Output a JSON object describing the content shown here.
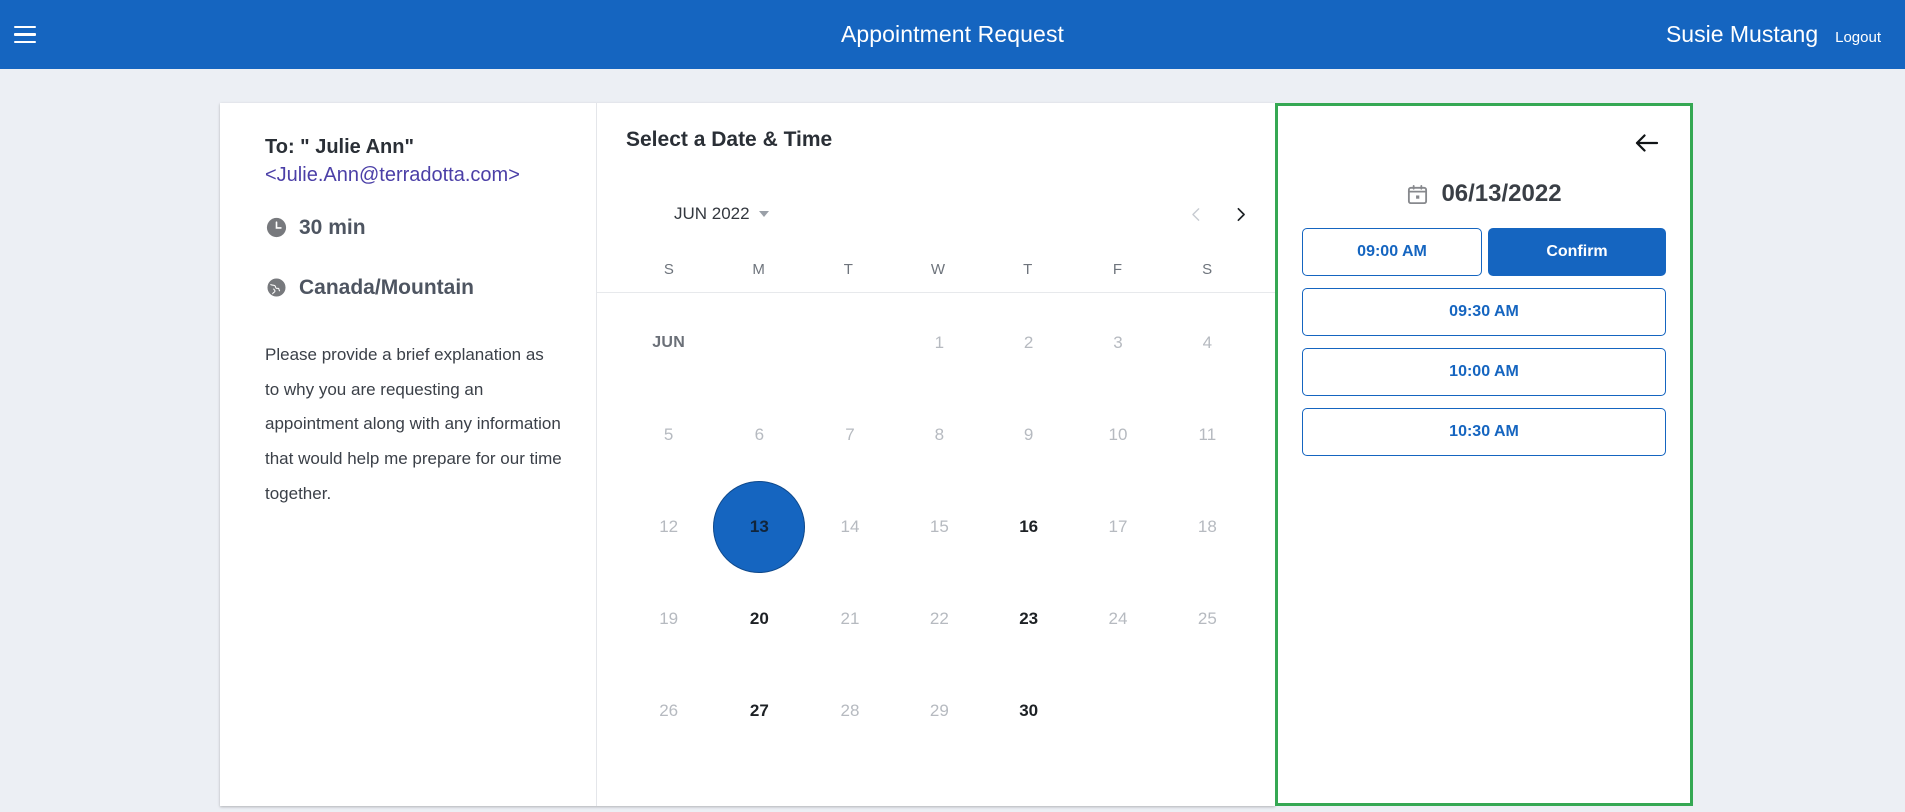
{
  "appbar": {
    "menu_icon": "hamburger-menu-icon",
    "title": "Appointment Request",
    "user_name": "Susie Mustang",
    "logout_label": "Logout",
    "background_color": "#1565c0"
  },
  "info": {
    "to_label": "To: \" Julie Ann\"",
    "to_email": "<Julie.Ann@terradotta.com>",
    "duration_icon": "clock-icon",
    "duration": "30 min",
    "timezone_icon": "globe-icon",
    "timezone": "Canada/Mountain",
    "description": "Please provide a brief explanation as to why you are requesting an appointment along with any information that would help me prepare for our time together."
  },
  "calendar": {
    "title": "Select a Date & Time",
    "month_label": "JUN 2022",
    "month_caret_icon": "chevron-down-icon",
    "prev_icon": "chevron-left-icon",
    "next_icon": "chevron-right-icon",
    "prev_disabled": true,
    "next_disabled": false,
    "weekdays": [
      "S",
      "M",
      "T",
      "W",
      "T",
      "F",
      "S"
    ],
    "month_tag": "JUN",
    "selected_day": "13",
    "weeks": [
      [
        {
          "label": "JUN",
          "type": "month-tag"
        },
        {
          "label": "",
          "type": "empty"
        },
        {
          "label": "",
          "type": "empty"
        },
        {
          "label": "1",
          "type": "disabled"
        },
        {
          "label": "2",
          "type": "disabled"
        },
        {
          "label": "3",
          "type": "disabled"
        },
        {
          "label": "4",
          "type": "disabled"
        }
      ],
      [
        {
          "label": "5",
          "type": "disabled"
        },
        {
          "label": "6",
          "type": "disabled"
        },
        {
          "label": "7",
          "type": "disabled"
        },
        {
          "label": "8",
          "type": "disabled"
        },
        {
          "label": "9",
          "type": "disabled"
        },
        {
          "label": "10",
          "type": "disabled"
        },
        {
          "label": "11",
          "type": "disabled"
        }
      ],
      [
        {
          "label": "12",
          "type": "disabled"
        },
        {
          "label": "13",
          "type": "selected"
        },
        {
          "label": "14",
          "type": "disabled"
        },
        {
          "label": "15",
          "type": "disabled"
        },
        {
          "label": "16",
          "type": "available"
        },
        {
          "label": "17",
          "type": "disabled"
        },
        {
          "label": "18",
          "type": "disabled"
        }
      ],
      [
        {
          "label": "19",
          "type": "disabled"
        },
        {
          "label": "20",
          "type": "available"
        },
        {
          "label": "21",
          "type": "disabled"
        },
        {
          "label": "22",
          "type": "disabled"
        },
        {
          "label": "23",
          "type": "available"
        },
        {
          "label": "24",
          "type": "disabled"
        },
        {
          "label": "25",
          "type": "disabled"
        }
      ],
      [
        {
          "label": "26",
          "type": "disabled"
        },
        {
          "label": "27",
          "type": "available"
        },
        {
          "label": "28",
          "type": "disabled"
        },
        {
          "label": "29",
          "type": "disabled"
        },
        {
          "label": "30",
          "type": "available"
        },
        {
          "label": "",
          "type": "empty"
        },
        {
          "label": "",
          "type": "empty"
        }
      ]
    ]
  },
  "time_panel": {
    "back_icon": "arrow-left-icon",
    "date_icon": "calendar-icon",
    "date": "06/13/2022",
    "confirm_label": "Confirm",
    "selected_slot": "09:00 AM",
    "slots": [
      "09:00 AM",
      "09:30 AM",
      "10:00 AM",
      "10:30 AM"
    ],
    "border_color": "#35a853",
    "accent_color": "#1565c0"
  }
}
